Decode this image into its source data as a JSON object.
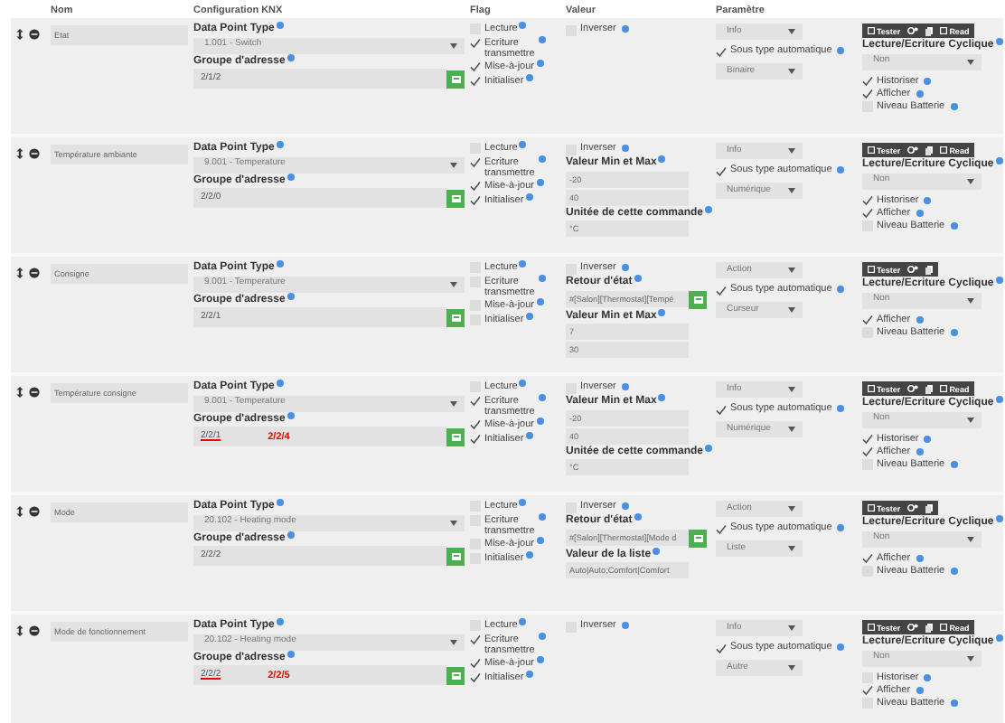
{
  "headers": [
    "Nom",
    "Configuration KNX",
    "Flag",
    "Valeur",
    "Paramètre"
  ],
  "rows": [
    {
      "name": "Etat",
      "dpt_label": "Data Point Type",
      "dpt": "1.001 - Switch",
      "group_label": "Groupe d'adresse",
      "group": {
        "value": "2/1/2",
        "struck": false
      },
      "flags": [
        {
          "label": "Lecture",
          "checked": false
        },
        {
          "label": "Ecriture transmettre",
          "checked": true
        },
        {
          "label": "Mise-à-jour",
          "checked": true
        },
        {
          "label": "Initialiser",
          "checked": true
        }
      ],
      "valeur": [
        {
          "kind": "checkbox",
          "label": "Inverser",
          "checked": false
        }
      ],
      "parametre": {
        "type": "Info",
        "auto_label": "Sous type automatique",
        "auto_checked": true,
        "subtype": "Binaire"
      },
      "toolbar": {
        "tester": "Tester",
        "read": "Read"
      },
      "cyclic_label": "Lecture/Ecriture Cyclique",
      "cyclic": "Non",
      "options": [
        {
          "label": "Historiser",
          "checked": true
        },
        {
          "label": "Afficher",
          "checked": true
        },
        {
          "label": "Niveau Batterie",
          "checked": false
        }
      ]
    },
    {
      "name": "Température ambiante",
      "dpt_label": "Data Point Type",
      "dpt": "9.001 - Temperature",
      "group_label": "Groupe d'adresse",
      "group": {
        "value": "2/2/0",
        "struck": false
      },
      "flags": [
        {
          "label": "Lecture",
          "checked": false
        },
        {
          "label": "Ecriture transmettre",
          "checked": true
        },
        {
          "label": "Mise-à-jour",
          "checked": true
        },
        {
          "label": "Initialiser",
          "checked": true
        }
      ],
      "valeur": [
        {
          "kind": "checkbox",
          "label": "Inverser",
          "checked": false
        },
        {
          "kind": "label",
          "text": "Valeur Min et Max"
        },
        {
          "kind": "field",
          "value": "-20"
        },
        {
          "kind": "field",
          "value": "40"
        },
        {
          "kind": "label",
          "text": "Unitée de cette commande"
        },
        {
          "kind": "field",
          "value": "°C"
        }
      ],
      "parametre": {
        "type": "Info",
        "auto_label": "Sous type automatique",
        "auto_checked": true,
        "subtype": "Numérique"
      },
      "toolbar": {
        "tester": "Tester",
        "read": "Read"
      },
      "cyclic_label": "Lecture/Ecriture Cyclique",
      "cyclic": "Non",
      "options": [
        {
          "label": "Historiser",
          "checked": true
        },
        {
          "label": "Afficher",
          "checked": true
        },
        {
          "label": "Niveau Batterie",
          "checked": false
        }
      ]
    },
    {
      "name": "Consigne",
      "dpt_label": "Data Point Type",
      "dpt": "9.001 - Temperature",
      "group_label": "Groupe d'adresse",
      "group": {
        "value": "2/2/1",
        "struck": false
      },
      "flags": [
        {
          "label": "Lecture",
          "checked": false
        },
        {
          "label": "Ecriture transmettre",
          "checked": false
        },
        {
          "label": "Mise-à-jour",
          "checked": false
        },
        {
          "label": "Initialiser",
          "checked": false
        }
      ],
      "valeur": [
        {
          "kind": "checkbox",
          "label": "Inverser",
          "checked": false
        },
        {
          "kind": "label",
          "text": "Retour d'état"
        },
        {
          "kind": "linked",
          "value": "#[Salon][Thermostat][Tempé"
        },
        {
          "kind": "label",
          "text": "Valeur Min et Max"
        },
        {
          "kind": "field",
          "value": "7"
        },
        {
          "kind": "field",
          "value": "30"
        }
      ],
      "parametre": {
        "type": "Action",
        "auto_label": "Sous type automatique",
        "auto_checked": true,
        "subtype": "Curseur"
      },
      "toolbar": {
        "tester": "Tester"
      },
      "cyclic_label": "Lecture/Ecriture Cyclique",
      "cyclic": "Non",
      "options": [
        {
          "label": "Afficher",
          "checked": true
        },
        {
          "label": "Niveau Batterie",
          "checked": false
        }
      ]
    },
    {
      "name": "Température consigne",
      "dpt_label": "Data Point Type",
      "dpt": "9.001 - Temperature",
      "group_label": "Groupe d'adresse",
      "group": {
        "value": "2/2/1",
        "struck": true,
        "correction": "2/2/4"
      },
      "flags": [
        {
          "label": "Lecture",
          "checked": false
        },
        {
          "label": "Ecriture transmettre",
          "checked": true
        },
        {
          "label": "Mise-à-jour",
          "checked": true
        },
        {
          "label": "Initialiser",
          "checked": true
        }
      ],
      "valeur": [
        {
          "kind": "checkbox",
          "label": "Inverser",
          "checked": false
        },
        {
          "kind": "label",
          "text": "Valeur Min et Max"
        },
        {
          "kind": "field",
          "value": "-20"
        },
        {
          "kind": "field",
          "value": "40"
        },
        {
          "kind": "label",
          "text": "Unitée de cette commande"
        },
        {
          "kind": "field",
          "value": "°C"
        }
      ],
      "parametre": {
        "type": "Info",
        "auto_label": "Sous type automatique",
        "auto_checked": true,
        "subtype": "Numérique"
      },
      "toolbar": {
        "tester": "Tester",
        "read": "Read"
      },
      "cyclic_label": "Lecture/Ecriture Cyclique",
      "cyclic": "Non",
      "options": [
        {
          "label": "Historiser",
          "checked": true
        },
        {
          "label": "Afficher",
          "checked": true
        },
        {
          "label": "Niveau Batterie",
          "checked": false
        }
      ]
    },
    {
      "name": "Mode",
      "dpt_label": "Data Point Type",
      "dpt": "20.102 - Heating mode",
      "group_label": "Groupe d'adresse",
      "group": {
        "value": "2/2/2",
        "struck": false
      },
      "flags": [
        {
          "label": "Lecture",
          "checked": false
        },
        {
          "label": "Ecriture transmettre",
          "checked": false
        },
        {
          "label": "Mise-à-jour",
          "checked": false
        },
        {
          "label": "Initialiser",
          "checked": false
        }
      ],
      "valeur": [
        {
          "kind": "checkbox",
          "label": "Inverser",
          "checked": false
        },
        {
          "kind": "label",
          "text": "Retour d'état"
        },
        {
          "kind": "linked",
          "value": "#[Salon][Thermostat][Mode d"
        },
        {
          "kind": "label",
          "text": "Valeur de la liste"
        },
        {
          "kind": "field",
          "value": "Auto|Auto;Comfort|Comfort"
        }
      ],
      "parametre": {
        "type": "Action",
        "auto_label": "Sous type automatique",
        "auto_checked": true,
        "subtype": "Liste"
      },
      "toolbar": {
        "tester": "Tester"
      },
      "cyclic_label": "Lecture/Ecriture Cyclique",
      "cyclic": "Non",
      "options": [
        {
          "label": "Afficher",
          "checked": true
        },
        {
          "label": "Niveau Batterie",
          "checked": false
        }
      ]
    },
    {
      "name": "Mode de fonctionnement",
      "dpt_label": "Data Point Type",
      "dpt": "20.102 - Heating mode",
      "group_label": "Groupe d'adresse",
      "group": {
        "value": "2/2/2",
        "struck": true,
        "correction": "2/2/5"
      },
      "flags": [
        {
          "label": "Lecture",
          "checked": false
        },
        {
          "label": "Ecriture transmettre",
          "checked": true
        },
        {
          "label": "Mise-à-jour",
          "checked": true
        },
        {
          "label": "Initialiser",
          "checked": true
        }
      ],
      "valeur": [
        {
          "kind": "checkbox",
          "label": "Inverser",
          "checked": false
        }
      ],
      "parametre": {
        "type": "Info",
        "auto_label": "Sous type automatique",
        "auto_checked": true,
        "subtype": "Autre"
      },
      "toolbar": {
        "tester": "Tester",
        "read": "Read"
      },
      "cyclic_label": "Lecture/Ecriture Cyclique",
      "cyclic": "Non",
      "options": [
        {
          "label": "Historiser",
          "checked": false
        },
        {
          "label": "Afficher",
          "checked": true
        },
        {
          "label": "Niveau Batterie",
          "checked": false
        }
      ]
    }
  ]
}
